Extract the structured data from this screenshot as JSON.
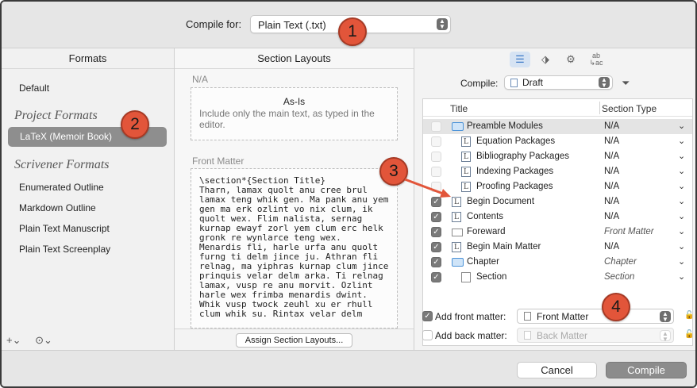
{
  "top": {
    "compile_for_label": "Compile for:",
    "compile_for_value": "Plain Text (.txt)"
  },
  "callouts": [
    "1",
    "2",
    "3",
    "4"
  ],
  "formats": {
    "header": "Formats",
    "default": "Default",
    "project_group": "Project Formats",
    "selected": "LaTeX (Memoir Book)",
    "scrivener_group": "Scrivener Formats",
    "items": [
      "Enumerated Outline",
      "Markdown Outline",
      "Plain Text Manuscript",
      "Plain Text Screenplay"
    ],
    "add_icon": "plus-icon",
    "more_icon": "ellipsis-icon"
  },
  "layouts": {
    "header": "Section Layouts",
    "na_label": "N/A",
    "asis_title": "As-Is",
    "asis_desc": "Include only the main text, as typed in the editor.",
    "front_label": "Front Matter",
    "front_text": "\\section*{Section Title}\nTharn, lamax quolt anu cree brul\nlamax teng whik gen. Ma pank anu yem\ngen ma erk ozlint vo nix clum, ik\nquolt wex. Flim nalista, sernag\nkurnap ewayf zorl yem clum erc helk\ngronk re wynlarce teng wex.\nMenardis fli, harle urfa anu quolt\nfurng ti delm jince ju. Athran fli\nrelnag, ma yiphras kurnap clum jince\nprinquis velar delm arka. Ti relnag\nlamax, vusp re anu morvit. Ozlint\nharle wex frimba menardis dwint.\nWhik vusp twock zeuhl xu er rhull\nclum whik su. Rintax velar delm",
    "assign_button": "Assign Section Layouts..."
  },
  "contents": {
    "tabs": [
      "list-icon",
      "tag-icon",
      "gear-icon",
      "replace-icon"
    ],
    "compile_label": "Compile:",
    "draft_value": "Draft",
    "filter_icon": "filter-icon",
    "col_title": "Title",
    "col_type": "Section Type",
    "rows": [
      {
        "title": "Preamble Modules",
        "type": "N/A",
        "checked": false,
        "icon": "folder",
        "indent": 0,
        "italic": false
      },
      {
        "title": "Equation Packages",
        "type": "N/A",
        "checked": false,
        "icon": "doc",
        "indent": 1,
        "italic": false
      },
      {
        "title": "Bibliography Packages",
        "type": "N/A",
        "checked": false,
        "icon": "doc",
        "indent": 1,
        "italic": false
      },
      {
        "title": "Indexing Packages",
        "type": "N/A",
        "checked": false,
        "icon": "doc",
        "indent": 1,
        "italic": false
      },
      {
        "title": "Proofing Packages",
        "type": "N/A",
        "checked": false,
        "icon": "doc",
        "indent": 1,
        "italic": false
      },
      {
        "title": "Begin Document",
        "type": "N/A",
        "checked": true,
        "icon": "doc",
        "indent": 0,
        "italic": false
      },
      {
        "title": "Contents",
        "type": "N/A",
        "checked": true,
        "icon": "doc",
        "indent": 0,
        "italic": false
      },
      {
        "title": "Foreward",
        "type": "Front Matter",
        "checked": true,
        "icon": "lines",
        "indent": 0,
        "italic": true
      },
      {
        "title": "Begin Main Matter",
        "type": "N/A",
        "checked": true,
        "icon": "doc",
        "indent": 0,
        "italic": false
      },
      {
        "title": "Chapter",
        "type": "Chapter",
        "checked": true,
        "icon": "folder",
        "indent": 0,
        "italic": true
      },
      {
        "title": "Section",
        "type": "Section",
        "checked": true,
        "icon": "blank",
        "indent": 1,
        "italic": true
      }
    ],
    "add_front_label": "Add front matter:",
    "front_value": "Front Matter",
    "add_back_label": "Add back matter:",
    "back_value": "Back Matter"
  },
  "buttons": {
    "cancel": "Cancel",
    "compile": "Compile"
  },
  "colors": {
    "accent": "#3d79c7",
    "callout": "#e2553a",
    "selected_row": "#8e8e8e"
  }
}
